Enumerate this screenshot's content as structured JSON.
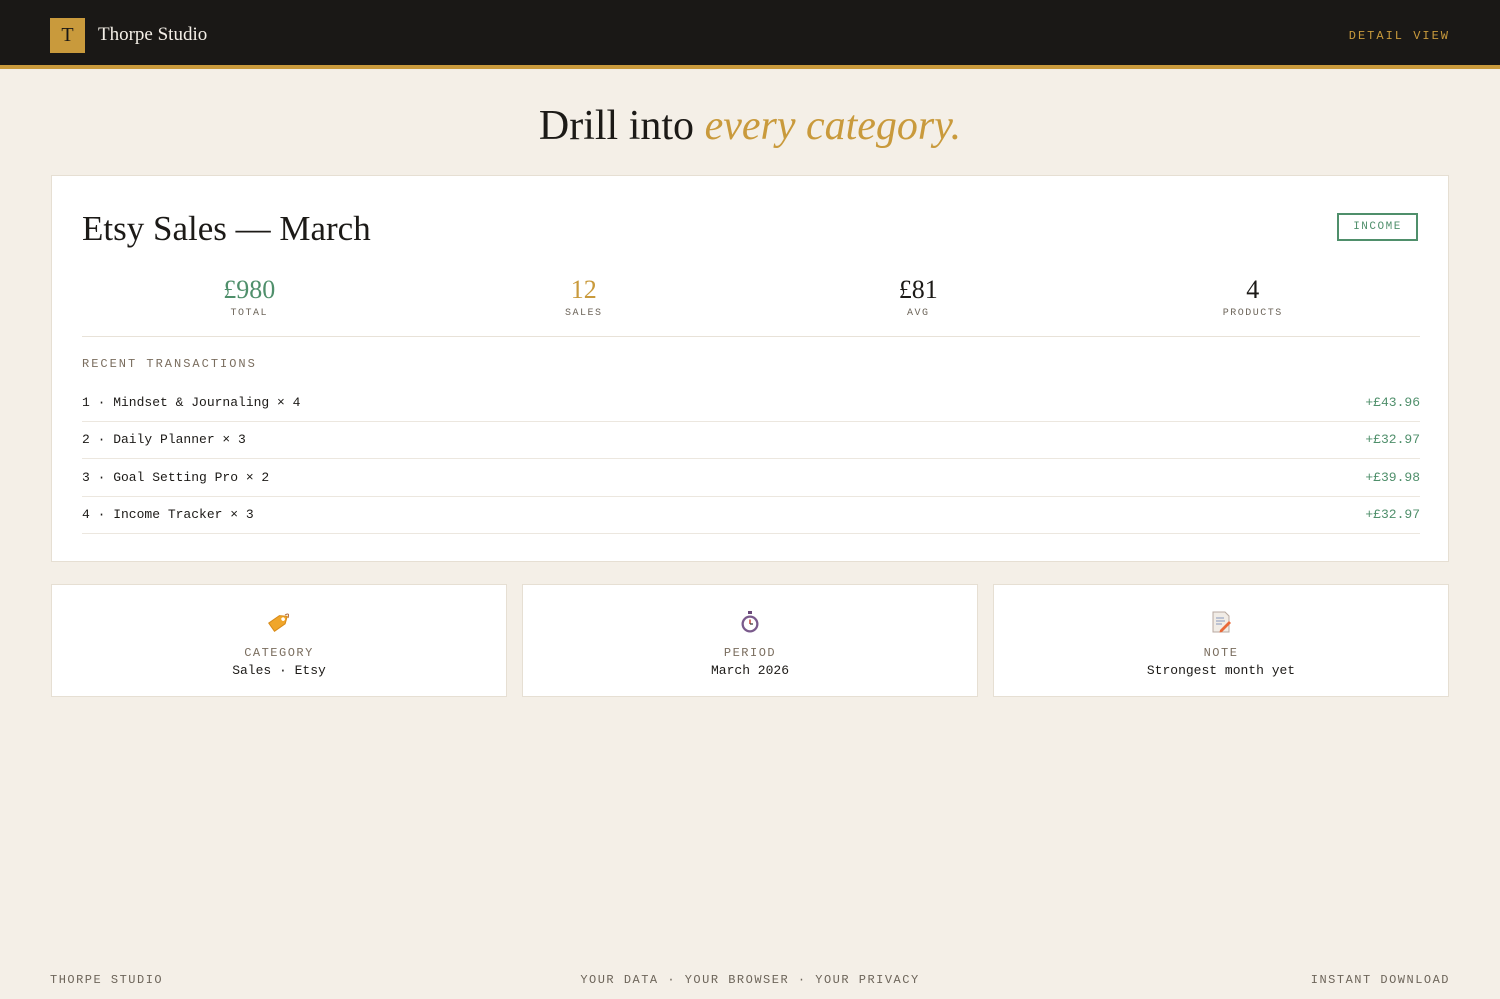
{
  "header": {
    "logo_letter": "T",
    "brand": "Thorpe Studio",
    "view_link": "DETAIL VIEW"
  },
  "hero": {
    "text": "Drill into",
    "accent": "every category."
  },
  "detail": {
    "title": "Etsy Sales — March",
    "badge": "INCOME",
    "stats": [
      {
        "value": "£980",
        "label": "TOTAL"
      },
      {
        "value": "12",
        "label": "SALES"
      },
      {
        "value": "£81",
        "label": "AVG"
      },
      {
        "value": "4",
        "label": "PRODUCTS"
      }
    ],
    "section_label": "RECENT TRANSACTIONS",
    "transactions": [
      {
        "name": "1 · Mindset & Journaling × 4",
        "amount": "+£43.96"
      },
      {
        "name": "2 · Daily Planner × 3",
        "amount": "+£32.97"
      },
      {
        "name": "3 · Goal Setting Pro × 2",
        "amount": "+£39.98"
      },
      {
        "name": "4 · Income Tracker × 3",
        "amount": "+£32.97"
      }
    ]
  },
  "info_cards": [
    {
      "icon": "tag-icon",
      "label": "CATEGORY",
      "value": "Sales · Etsy"
    },
    {
      "icon": "stopwatch-icon",
      "label": "PERIOD",
      "value": "March 2026"
    },
    {
      "icon": "memo-icon",
      "label": "NOTE",
      "value": "Strongest month yet"
    }
  ],
  "footer": {
    "left": "THORPE STUDIO",
    "center": "YOUR DATA · YOUR BROWSER · YOUR PRIVACY",
    "right": "INSTANT DOWNLOAD"
  },
  "colors": {
    "background": "#f4efe7",
    "header_bg": "#1a1816",
    "gold": "#c99a3c",
    "green": "#4f8f6b"
  }
}
